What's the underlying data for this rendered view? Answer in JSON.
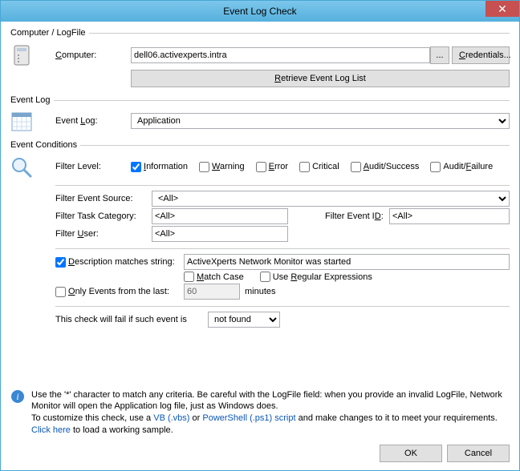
{
  "window": {
    "title": "Event Log Check"
  },
  "section1": {
    "legend": "Computer / LogFile",
    "computer_label": "Computer:",
    "computer_value": "dell06.activexperts.intra",
    "browse": "...",
    "credentials": "Credentials...",
    "retrieve": "Retrieve Event Log List"
  },
  "section2": {
    "legend": "Event Log",
    "eventlog_label": "Event Log:",
    "eventlog_value": "Application"
  },
  "section3": {
    "legend": "Event Conditions",
    "filter_level_label": "Filter Level:",
    "levels": {
      "information": "Information",
      "warning": "Warning",
      "error": "Error",
      "critical": "Critical",
      "audit_success": "Audit/Success",
      "audit_failure": "Audit/Failure"
    },
    "event_source_label": "Filter Event Source:",
    "event_source_value": "<All>",
    "task_category_label": "Filter Task Category:",
    "task_category_value": "<All>",
    "event_id_label": "Filter Event ID:",
    "event_id_value": "<All>",
    "filter_user_label": "Filter User:",
    "filter_user_value": "<All>",
    "desc_matches_label": "Description matches string:",
    "desc_value": "ActiveXperts Network Monitor was started",
    "match_case": "Match Case",
    "use_regex": "Use Regular Expressions",
    "only_events_label": "Only Events from the last:",
    "only_events_value": "60",
    "minutes": "minutes",
    "fail_label": "This check will fail if such event is",
    "fail_value": "not found"
  },
  "info": {
    "line1a": "Use the '*' character to match any criteria. Be careful with the LogFile field: when you provide an invalid LogFile, Network Monitor will open the Application log file, just as Windows does.",
    "line2a": "To customize this check, use a ",
    "vb": "VB (.vbs)",
    "line2b": "   or  ",
    "ps": "PowerShell (.ps1) script",
    "line2c": " and make changes to it to meet your requirements.",
    "clickhere": "Click here",
    "line3b": " to load a working sample."
  },
  "buttons": {
    "ok": "OK",
    "cancel": "Cancel"
  }
}
